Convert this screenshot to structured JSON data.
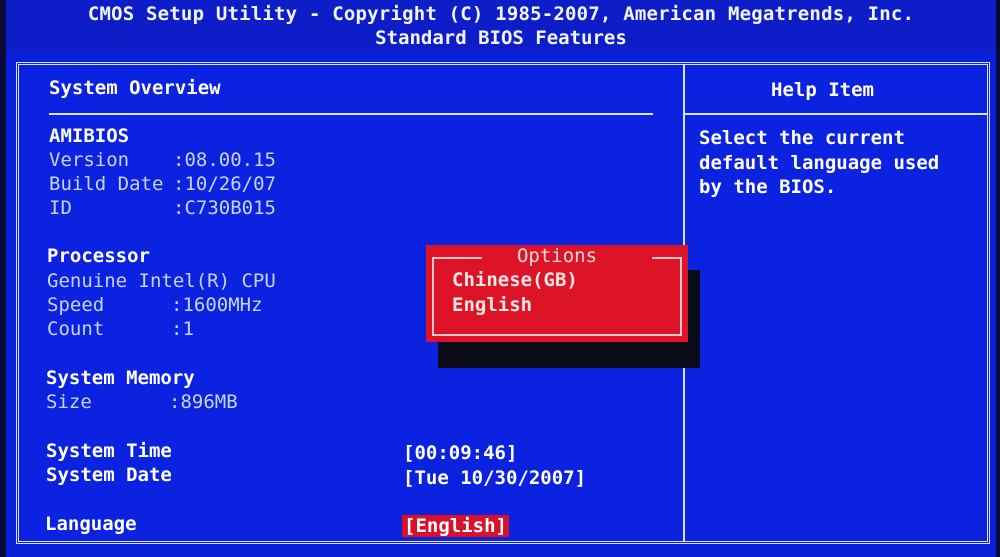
{
  "header": {
    "title": "CMOS Setup Utility - Copyright (C) 1985-2007, American Megatrends, Inc.",
    "subtitle": "Standard BIOS Features"
  },
  "overview": {
    "heading": "System Overview",
    "amibios": {
      "label": "AMIBIOS",
      "version_label": "Version    ",
      "version_value": ":08.00.15",
      "build_label": "Build Date",
      "build_value": ":10/26/07",
      "id_label": "ID         ",
      "id_value": ":C730B015"
    },
    "processor": {
      "label": "Processor",
      "name": "Genuine Intel(R) CPU",
      "speed_label": "Speed      ",
      "speed_value": ":1600MHz",
      "count_label": "Count      ",
      "count_value": ":1"
    },
    "memory": {
      "label": "System Memory",
      "size_label": "Size       ",
      "size_value": ":896MB"
    },
    "time": {
      "label": "System Time",
      "value": "[00:09:46]"
    },
    "date": {
      "label": "System Date",
      "value": "[Tue 10/30/2007]"
    },
    "language": {
      "label": "Language",
      "value": "[English]"
    }
  },
  "help": {
    "heading": "Help Item",
    "lines": [
      "Select the current",
      "default language used",
      "by the BIOS."
    ]
  },
  "options_popup": {
    "title": "Options",
    "items": [
      "Chinese(GB)",
      "English"
    ]
  },
  "colors": {
    "background": "#0b22e0",
    "popup": "#dd1428",
    "highlight": "#d8102a"
  }
}
